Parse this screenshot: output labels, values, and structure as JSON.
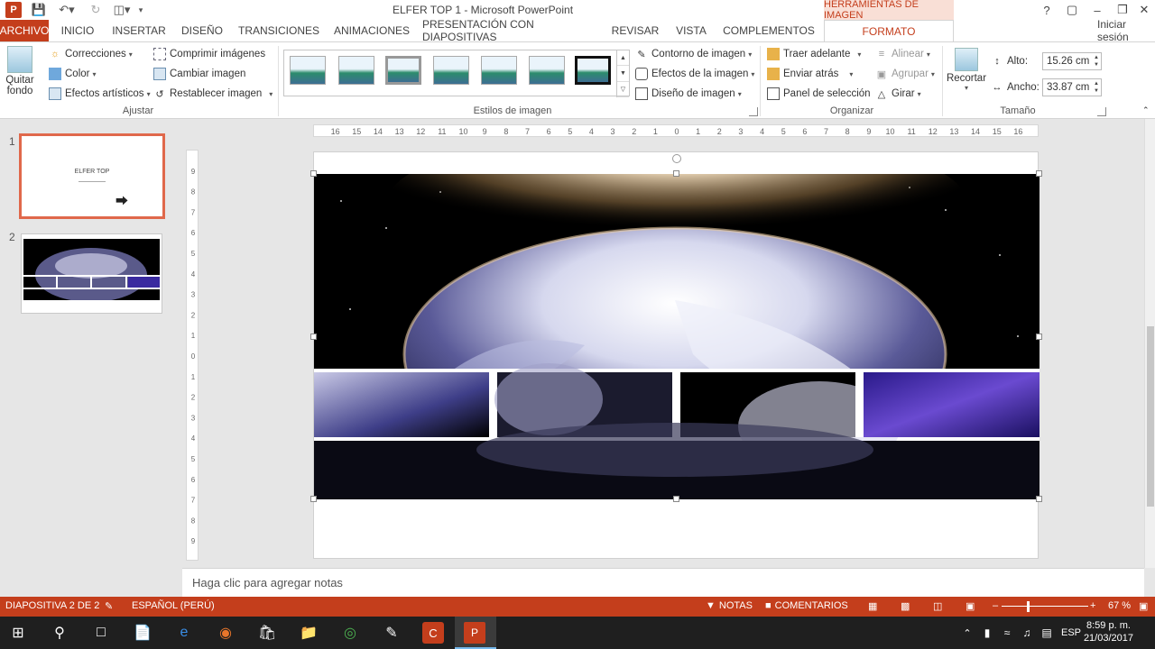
{
  "window": {
    "title": "ELFER TOP 1 - Microsoft PowerPoint",
    "context_tab": "HERRAMIENTAS DE IMAGEN",
    "controls": [
      "?",
      "▢",
      "–",
      "❐",
      "✕"
    ]
  },
  "tabs": {
    "file": "ARCHIVO",
    "items": [
      "INICIO",
      "INSERTAR",
      "DISEÑO",
      "TRANSICIONES",
      "ANIMACIONES",
      "PRESENTACIÓN CON DIAPOSITIVAS",
      "REVISAR",
      "VISTA",
      "COMPLEMENTOS"
    ],
    "active": "FORMATO",
    "signin": "Iniciar sesión"
  },
  "ribbon": {
    "quitar_fondo_1": "Quitar",
    "quitar_fondo_2": "fondo",
    "correcciones": "Correcciones",
    "color": "Color",
    "efectos_artisticos": "Efectos artísticos",
    "comprimir": "Comprimir imágenes",
    "cambiar": "Cambiar imagen",
    "restablecer": "Restablecer imagen",
    "group_ajustar": "Ajustar",
    "group_estilos": "Estilos de imagen",
    "contorno": "Contorno de imagen",
    "efectos_imagen": "Efectos de la imagen",
    "diseno_imagen": "Diseño de imagen",
    "traer": "Traer adelante",
    "enviar": "Enviar atrás",
    "panel": "Panel de selección",
    "alinear": "Alinear",
    "agrupar": "Agrupar",
    "girar": "Girar",
    "group_organizar": "Organizar",
    "recortar": "Recortar",
    "alto_label": "Alto:",
    "alto_value": "15.26 cm",
    "ancho_label": "Ancho:",
    "ancho_value": "33.87 cm",
    "group_tamano": "Tamaño"
  },
  "thumbnails": [
    {
      "number": "1",
      "title": "ELFER TOP"
    },
    {
      "number": "2"
    }
  ],
  "ruler": {
    "h_ticks": [
      "16",
      "15",
      "14",
      "13",
      "12",
      "11",
      "10",
      "9",
      "8",
      "7",
      "6",
      "5",
      "4",
      "3",
      "2",
      "1",
      "0",
      "1",
      "2",
      "3",
      "4",
      "5",
      "6",
      "7",
      "8",
      "9",
      "10",
      "11",
      "12",
      "13",
      "14",
      "15",
      "16"
    ],
    "v_ticks": [
      "9",
      "8",
      "7",
      "6",
      "5",
      "4",
      "3",
      "2",
      "1",
      "0",
      "1",
      "2",
      "3",
      "4",
      "5",
      "6",
      "7",
      "8",
      "9"
    ]
  },
  "notes_placeholder": "Haga clic para agregar notas",
  "statusbar": {
    "slide_info": "DIAPOSITIVA 2 DE 2",
    "language": "ESPAÑOL (PERÚ)",
    "notes": "NOTAS",
    "comments": "COMENTARIOS",
    "zoom": "67 %"
  },
  "taskbar": {
    "lang": "ESP",
    "time": "8:59 p. m.",
    "date": "21/03/2017"
  }
}
